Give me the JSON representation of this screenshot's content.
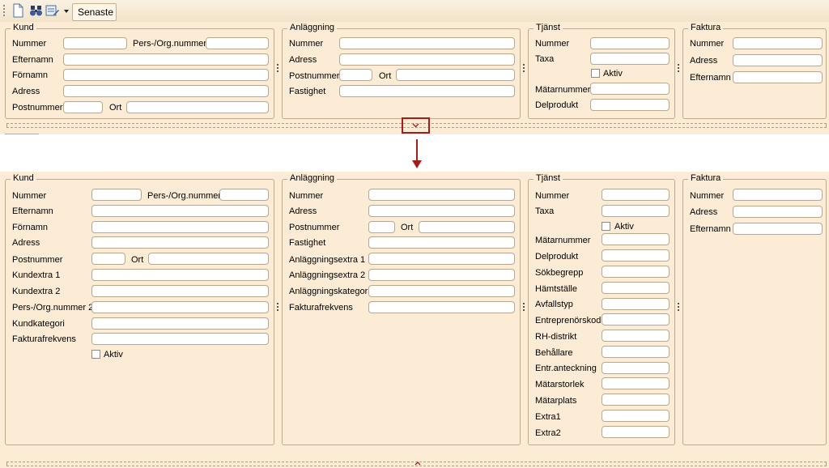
{
  "toolbar": {
    "new_icon": "new-document-icon",
    "search_icon": "binoculars-icon",
    "form_icon": "form-edit-icon",
    "dropdown_icon": "chevron-down-icon",
    "recent_label": "Senaste"
  },
  "top": {
    "kund": {
      "title": "Kund",
      "nummer": "Nummer",
      "persorg": "Pers-/Org.nummer",
      "efternamn": "Efternamn",
      "fornamn": "Förnamn",
      "adress": "Adress",
      "postnummer": "Postnummer",
      "ort": "Ort"
    },
    "anlaggning": {
      "title": "Anläggning",
      "nummer": "Nummer",
      "adress": "Adress",
      "postnummer": "Postnummer",
      "ort": "Ort",
      "fastighet": "Fastighet"
    },
    "tjanst": {
      "title": "Tjänst",
      "nummer": "Nummer",
      "taxa": "Taxa",
      "aktiv": "Aktiv",
      "matarnummer": "Mätarnummer",
      "delprodukt": "Delprodukt"
    },
    "faktura": {
      "title": "Faktura",
      "nummer": "Nummer",
      "adress": "Adress",
      "efternamn": "Efternamn"
    }
  },
  "bottom": {
    "kund": {
      "title": "Kund",
      "nummer": "Nummer",
      "persorg": "Pers-/Org.nummer",
      "efternamn": "Efternamn",
      "fornamn": "Förnamn",
      "adress": "Adress",
      "postnummer": "Postnummer",
      "ort": "Ort",
      "kundextra1": "Kundextra 1",
      "kundextra2": "Kundextra 2",
      "persorg2": "Pers-/Org.nummer 2",
      "kundkategori": "Kundkategori",
      "fakturafrekvens": "Fakturafrekvens",
      "aktiv": "Aktiv"
    },
    "anlaggning": {
      "title": "Anläggning",
      "nummer": "Nummer",
      "adress": "Adress",
      "postnummer": "Postnummer",
      "ort": "Ort",
      "fastighet": "Fastighet",
      "extra1": "Anläggningsextra 1",
      "extra2": "Anläggningsextra 2",
      "kategori": "Anläggningskategori",
      "fakturafrekvens": "Fakturafrekvens"
    },
    "tjanst": {
      "title": "Tjänst",
      "nummer": "Nummer",
      "taxa": "Taxa",
      "aktiv": "Aktiv",
      "matarnummer": "Mätarnummer",
      "delprodukt": "Delprodukt",
      "sokbegrepp": "Sökbegrepp",
      "hamtstalle": "Hämtställe",
      "avfallstyp": "Avfallstyp",
      "entreprenorskod": "Entreprenörskod",
      "rhdistrikt": "RH-distrikt",
      "behallare": "Behållare",
      "entranteckning": "Entr.anteckning",
      "matarstorlek": "Mätarstorlek",
      "matarplats": "Mätarplats",
      "extra1": "Extra1",
      "extra2": "Extra2"
    },
    "faktura": {
      "title": "Faktura",
      "nummer": "Nummer",
      "adress": "Adress",
      "efternamn": "Efternamn"
    }
  },
  "colors": {
    "panel_bg": "#fcecd5",
    "border": "#bfa98a",
    "highlight": "#a51c1c"
  }
}
